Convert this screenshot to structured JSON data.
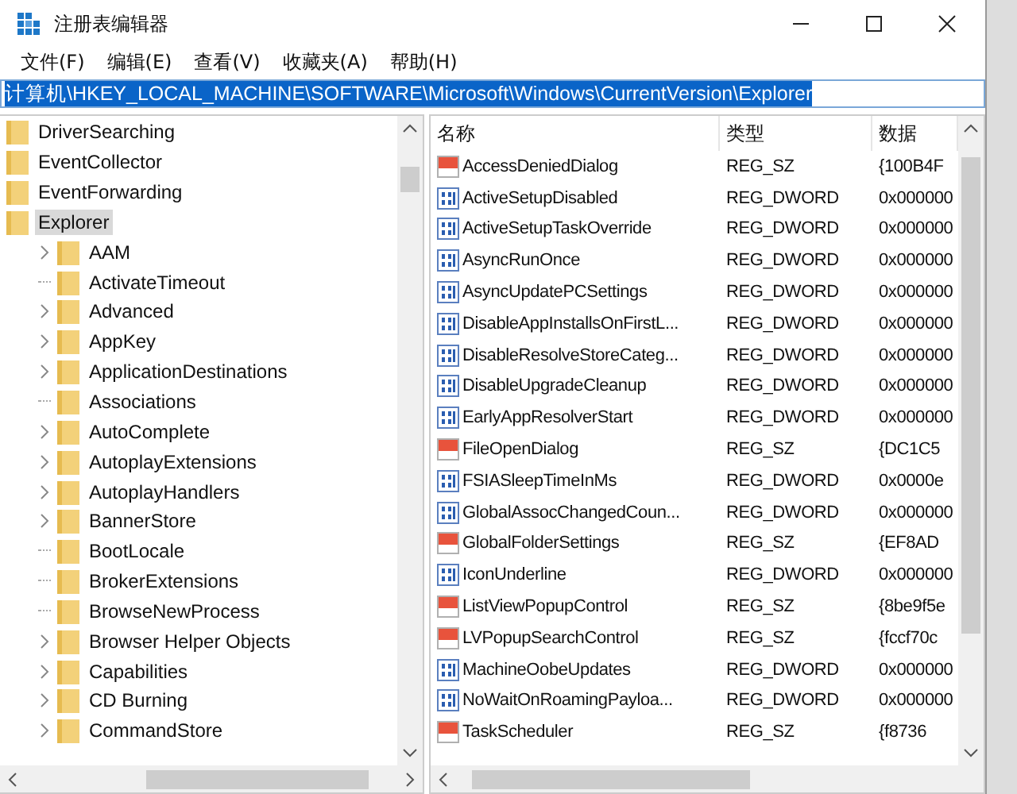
{
  "window": {
    "title": "注册表编辑器"
  },
  "menu": [
    "文件(F)",
    "编辑(E)",
    "查看(V)",
    "收藏夹(A)",
    "帮助(H)"
  ],
  "address": {
    "value": "计算机\\HKEY_LOCAL_MACHINE\\SOFTWARE\\Microsoft\\Windows\\CurrentVersion\\Explorer"
  },
  "tree": [
    {
      "label": "DriverSearching",
      "selected": false
    },
    {
      "label": "EventCollector",
      "selected": false
    },
    {
      "label": "EventForwarding",
      "selected": false
    },
    {
      "label": "Explorer",
      "selected": true,
      "children": [
        {
          "label": "AAM",
          "selected": false,
          "expandable": true
        },
        {
          "label": "ActivateTimeout",
          "selected": false,
          "expandable": false
        },
        {
          "label": "Advanced",
          "selected": false,
          "expandable": true
        },
        {
          "label": "AppKey",
          "selected": false,
          "expandable": true
        },
        {
          "label": "ApplicationDestinations",
          "selected": false,
          "expandable": true
        },
        {
          "label": "Associations",
          "selected": false,
          "expandable": false
        },
        {
          "label": "AutoComplete",
          "selected": false,
          "expandable": true
        },
        {
          "label": "AutoplayExtensions",
          "selected": false,
          "expandable": true
        },
        {
          "label": "AutoplayHandlers",
          "selected": false,
          "expandable": true
        },
        {
          "label": "BannerStore",
          "selected": false,
          "expandable": true
        },
        {
          "label": "BootLocale",
          "selected": false,
          "expandable": false
        },
        {
          "label": "BrokerExtensions",
          "selected": false,
          "expandable": false
        },
        {
          "label": "BrowseNewProcess",
          "selected": false,
          "expandable": false
        },
        {
          "label": "Browser Helper Objects",
          "selected": false,
          "expandable": true
        },
        {
          "label": "Capabilities",
          "selected": false,
          "expandable": true
        },
        {
          "label": "CD Burning",
          "selected": false,
          "expandable": true
        },
        {
          "label": "CommandStore",
          "selected": false,
          "expandable": true
        }
      ]
    }
  ],
  "table": {
    "columns": [
      "名称",
      "类型",
      "数据"
    ],
    "rows": [
      {
        "kind": "string",
        "name": "AccessDeniedDialog",
        "type": "REG_SZ",
        "data": "{100B4F"
      },
      {
        "kind": "binary",
        "name": "ActiveSetupDisabled",
        "type": "REG_DWORD",
        "data": "0x000000"
      },
      {
        "kind": "binary",
        "name": "ActiveSetupTaskOverride",
        "type": "REG_DWORD",
        "data": "0x000000"
      },
      {
        "kind": "binary",
        "name": "AsyncRunOnce",
        "type": "REG_DWORD",
        "data": "0x000000"
      },
      {
        "kind": "binary",
        "name": "AsyncUpdatePCSettings",
        "type": "REG_DWORD",
        "data": "0x000000"
      },
      {
        "kind": "binary",
        "name": "DisableAppInstallsOnFirstL...",
        "type": "REG_DWORD",
        "data": "0x000000"
      },
      {
        "kind": "binary",
        "name": "DisableResolveStoreCateg...",
        "type": "REG_DWORD",
        "data": "0x000000"
      },
      {
        "kind": "binary",
        "name": "DisableUpgradeCleanup",
        "type": "REG_DWORD",
        "data": "0x000000"
      },
      {
        "kind": "binary",
        "name": "EarlyAppResolverStart",
        "type": "REG_DWORD",
        "data": "0x000000"
      },
      {
        "kind": "string",
        "name": "FileOpenDialog",
        "type": "REG_SZ",
        "data": "{DC1C5"
      },
      {
        "kind": "binary",
        "name": "FSIASleepTimeInMs",
        "type": "REG_DWORD",
        "data": "0x0000e"
      },
      {
        "kind": "binary",
        "name": "GlobalAssocChangedCoun...",
        "type": "REG_DWORD",
        "data": "0x000000"
      },
      {
        "kind": "string",
        "name": "GlobalFolderSettings",
        "type": "REG_SZ",
        "data": "{EF8AD"
      },
      {
        "kind": "binary",
        "name": "IconUnderline",
        "type": "REG_DWORD",
        "data": "0x000000"
      },
      {
        "kind": "string",
        "name": "ListViewPopupControl",
        "type": "REG_SZ",
        "data": "{8be9f5e"
      },
      {
        "kind": "string",
        "name": "LVPopupSearchControl",
        "type": "REG_SZ",
        "data": "{fccf70c"
      },
      {
        "kind": "binary",
        "name": "MachineOobeUpdates",
        "type": "REG_DWORD",
        "data": "0x000000"
      },
      {
        "kind": "binary",
        "name": "NoWaitOnRoamingPayloa...",
        "type": "REG_DWORD",
        "data": "0x000000"
      },
      {
        "kind": "string",
        "name": "TaskScheduler",
        "type": "REG_SZ",
        "data": "{f8736"
      }
    ]
  }
}
